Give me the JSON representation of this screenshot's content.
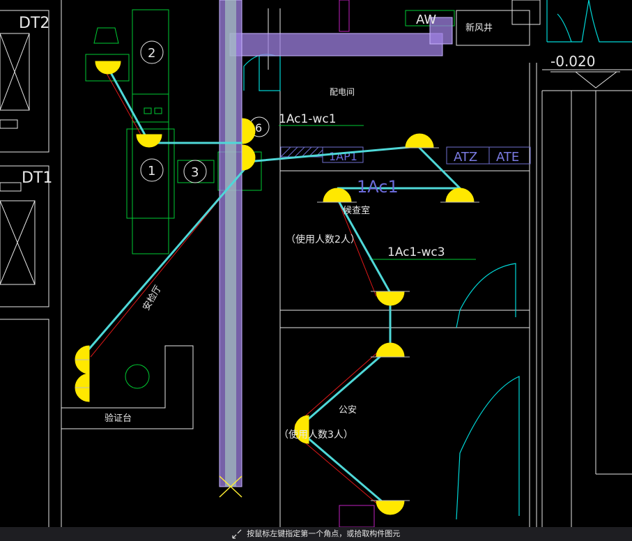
{
  "labels": {
    "dt2": "DT2",
    "dt1": "DT1",
    "aw": "AW",
    "fresh_air_shaft": "新风井",
    "elevation": "-0.020",
    "distribution_room": "配电间",
    "circuit_wc1": "1Ac1-wc1",
    "panel_1ap1": "1AP1",
    "panel_atz": "ATZ",
    "panel_ate": "ATE",
    "circuit_1ac1": "1Ac1",
    "waiting_room": "候查室",
    "occupancy_2": "（使用人数2人）",
    "circuit_wc3": "1Ac1-wc3",
    "security_hall": "安检厅",
    "verification_desk": "验证台",
    "public_security": "公安",
    "occupancy_3": "（使用人数3人）",
    "num_1": "1",
    "num_2": "2",
    "num_3": "3",
    "num_6": "6"
  },
  "status": {
    "prompt": "按鼠标左键指定第一个角点，或拾取构件图元"
  }
}
